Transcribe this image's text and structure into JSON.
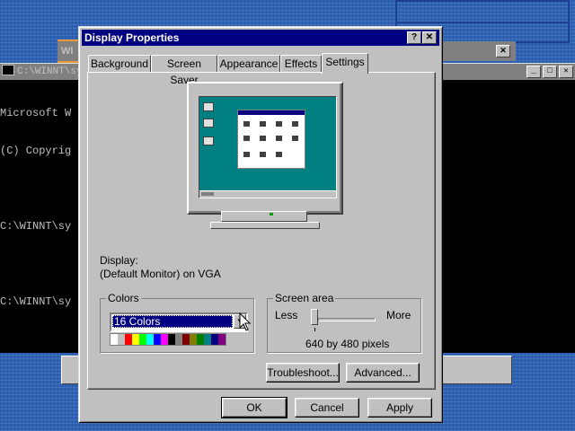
{
  "console": {
    "title": "C:\\WINNT\\sy",
    "lines": [
      "Microsoft W",
      "(C) Copyrig",
      "",
      "C:\\WINNT\\sy",
      "",
      "C:\\WINNT\\sy"
    ]
  },
  "background_window": {
    "title": "WI"
  },
  "dialog": {
    "title": "Display Properties",
    "help_label": "?",
    "close_label": "✕",
    "tabs": [
      "Background",
      "Screen Saver",
      "Appearance",
      "Effects",
      "Settings"
    ],
    "active_tab": "Settings",
    "display_label": "Display:",
    "display_value": "(Default Monitor) on VGA",
    "colors": {
      "legend": "Colors",
      "selected": "16 Colors",
      "palette": [
        "#ffffff",
        "#c0c0c0",
        "#ff0000",
        "#ffff00",
        "#00ff00",
        "#00ffff",
        "#0000ff",
        "#ff00ff",
        "#000000",
        "#808080",
        "#800000",
        "#808000",
        "#008000",
        "#008080",
        "#000080",
        "#800080"
      ]
    },
    "screen_area": {
      "legend": "Screen area",
      "less_label": "Less",
      "more_label": "More",
      "resolution": "640 by 480 pixels",
      "slider_position": 0
    },
    "troubleshoot_label": "Troubleshoot...",
    "advanced_label": "Advanced...",
    "ok_label": "OK",
    "cancel_label": "Cancel",
    "apply_label": "Apply"
  }
}
